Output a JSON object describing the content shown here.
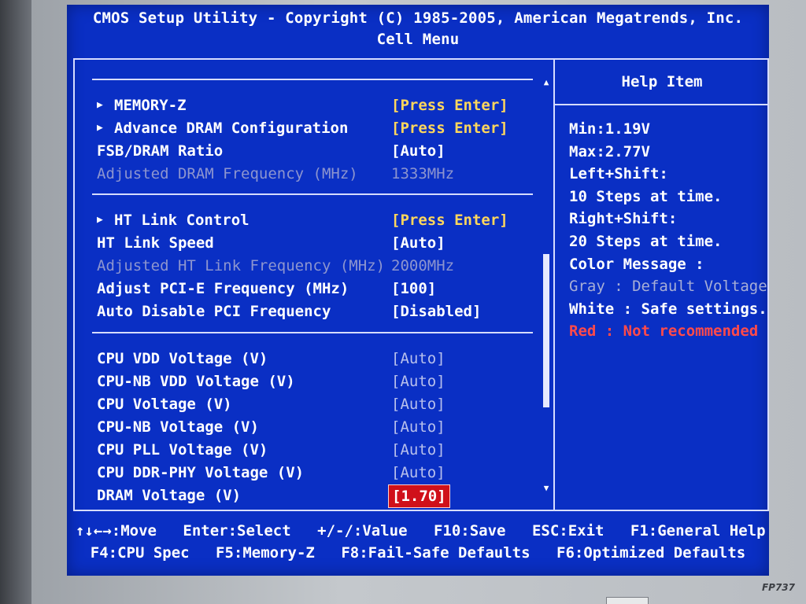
{
  "header": {
    "title": "CMOS Setup Utility - Copyright (C) 1985-2005, American Megatrends, Inc.",
    "subtitle": "Cell Menu"
  },
  "menu": {
    "items": [
      {
        "label": "MEMORY-Z",
        "value": "[Press Enter]",
        "submenu": true
      },
      {
        "label": "Advance DRAM Configuration",
        "value": "[Press Enter]",
        "submenu": true
      },
      {
        "label": "FSB/DRAM Ratio",
        "value": "[Auto]",
        "submenu": false
      },
      {
        "label": "Adjusted DRAM Frequency (MHz)",
        "value": "1333MHz",
        "submenu": false,
        "disabled": true
      },
      {
        "label": "HT Link Control",
        "value": "[Press Enter]",
        "submenu": true
      },
      {
        "label": "HT Link Speed",
        "value": "[Auto]",
        "submenu": false
      },
      {
        "label": "Adjusted HT Link Frequency (MHz)",
        "value": "2000MHz",
        "submenu": false,
        "disabled": true
      },
      {
        "label": "Adjust PCI-E Frequency (MHz)",
        "value": "[100]",
        "submenu": false
      },
      {
        "label": "Auto Disable PCI Frequency",
        "value": "[Disabled]",
        "submenu": false
      },
      {
        "label": "CPU VDD Voltage (V)",
        "value": "[Auto]",
        "submenu": false
      },
      {
        "label": "CPU-NB VDD Voltage (V)",
        "value": "[Auto]",
        "submenu": false
      },
      {
        "label": "CPU Voltage (V)",
        "value": "[Auto]",
        "submenu": false
      },
      {
        "label": "CPU-NB Voltage (V)",
        "value": "[Auto]",
        "submenu": false
      },
      {
        "label": "CPU PLL Voltage (V)",
        "value": "[Auto]",
        "submenu": false
      },
      {
        "label": "CPU DDR-PHY Voltage (V)",
        "value": "[Auto]",
        "submenu": false
      },
      {
        "label": "DRAM Voltage (V)",
        "value": "[1.70]",
        "submenu": false,
        "selected": true
      }
    ]
  },
  "help": {
    "title": "Help Item",
    "lines": [
      "Min:1.19V",
      "Max:2.77V",
      "Left+Shift:",
      "10 Steps at time.",
      "Right+Shift:",
      "20 Steps at time.",
      "Color Message :",
      "Gray : Default Voltage",
      "White : Safe settings.",
      "Red : Not recommended"
    ]
  },
  "footer": {
    "line1": [
      "↑↓←→:Move",
      "Enter:Select",
      "+/-/:Value",
      "F10:Save",
      "ESC:Exit",
      "F1:General Help"
    ],
    "line2": [
      "F4:CPU Spec",
      "F5:Memory-Z",
      "F8:Fail-Safe Defaults",
      "F6:Optimized Defaults"
    ]
  },
  "monitor": {
    "model": "FP737"
  },
  "colors": {
    "screen_bg": "#0a2fc4",
    "value_highlight": "#ffd75c",
    "selected_bg": "#d0101a",
    "disabled_text": "#8d95cf",
    "warning_red": "#ff4a4a"
  }
}
